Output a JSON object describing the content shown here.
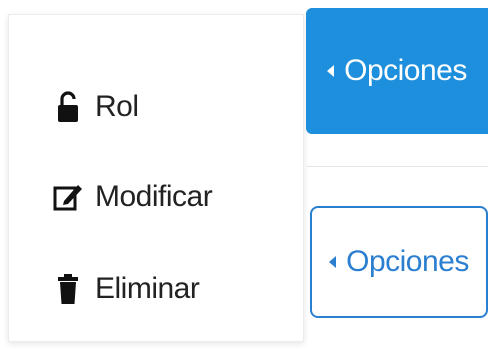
{
  "menu": {
    "items": [
      {
        "label": "Rol",
        "icon": "unlock-icon"
      },
      {
        "label": "Modificar",
        "icon": "edit-icon"
      },
      {
        "label": "Eliminar",
        "icon": "trash-icon"
      }
    ]
  },
  "buttons": {
    "primary": {
      "label": "Opciones",
      "icon": "caret-left-icon",
      "color": "#1d8fdc"
    },
    "outline": {
      "label": "Opciones",
      "icon": "caret-left-icon",
      "color": "#2b7fd1"
    }
  }
}
